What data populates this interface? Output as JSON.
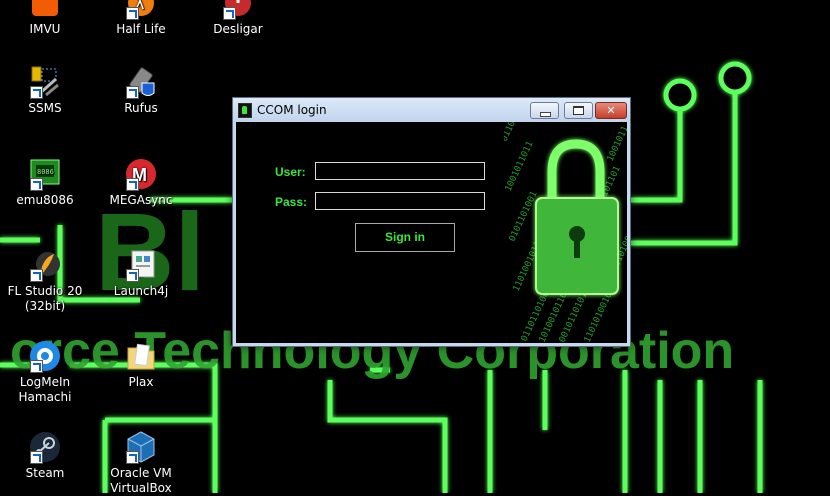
{
  "desktop": {
    "wallpaper": {
      "brand_partial": "Bl",
      "tagline": "orce Technology Corporation",
      "accent": "#39e639"
    },
    "icons": [
      {
        "label": "IMVU",
        "icon": "imvu-icon"
      },
      {
        "label": "Half Life",
        "icon": "half-life-icon"
      },
      {
        "label": "Desligar",
        "icon": "power-icon"
      },
      {
        "label": "SSMS",
        "icon": "ssms-icon"
      },
      {
        "label": "Rufus",
        "icon": "rufus-usb-icon"
      },
      {
        "label": "emu8086",
        "icon": "chip-icon"
      },
      {
        "label": "MEGAsync",
        "icon": "mega-icon"
      },
      {
        "label": "FL Studio 20\n(32bit)",
        "icon": "fl-studio-icon"
      },
      {
        "label": "Launch4j",
        "icon": "launch4j-icon"
      },
      {
        "label": "LogMeIn\nHamachi",
        "icon": "hamachi-icon"
      },
      {
        "label": "Plax",
        "icon": "folder-icon"
      },
      {
        "label": "Steam",
        "icon": "steam-icon"
      },
      {
        "label": "Oracle VM\nVirtualBox",
        "icon": "virtualbox-icon"
      }
    ]
  },
  "login_window": {
    "title": "CCOM login",
    "user_label": "User:",
    "user_value": "",
    "pass_label": "Pass:",
    "pass_value": "",
    "signin_label": "Sign in",
    "decoration": "padlock-binary-icon",
    "colors": {
      "text": "#39e639",
      "background": "#000000",
      "frame": "#c6d8ee"
    }
  }
}
